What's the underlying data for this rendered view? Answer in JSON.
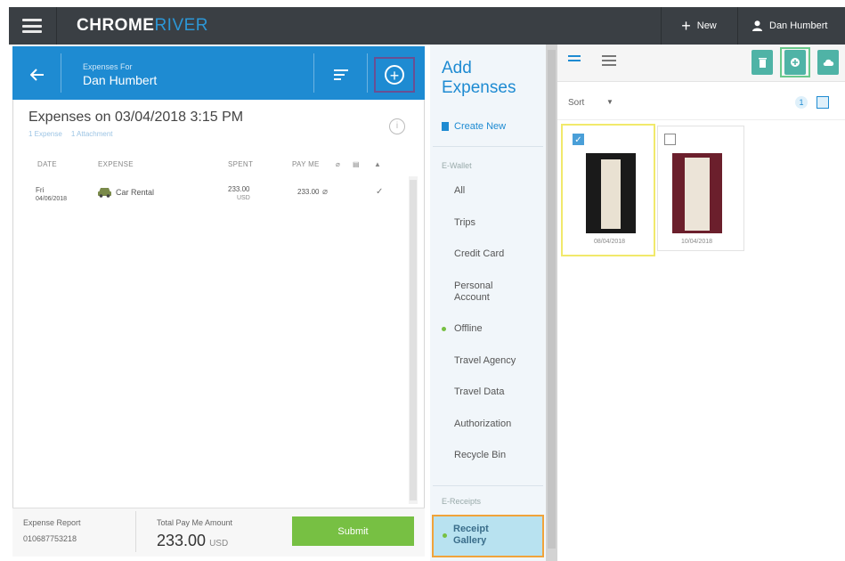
{
  "topbar": {
    "logo_main": "CHROME",
    "logo_accent": "RIVER",
    "new_label": "New",
    "user_name": "Dan Humbert"
  },
  "left": {
    "header_small": "Expenses For",
    "header_name": "Dan Humbert",
    "title": "Expenses on 03/04/2018 3:15 PM",
    "meta_expenses": "1 Expense",
    "meta_attachments": "1 Attachment",
    "columns": {
      "date": "DATE",
      "expense": "EXPENSE",
      "spent": "SPENT",
      "payme": "PAY ME"
    },
    "rows": [
      {
        "day": "Fri",
        "date": "04/06/2018",
        "expense": "Car Rental",
        "spent": "233.00",
        "spent_currency": "USD",
        "payme": "233.00"
      }
    ],
    "footer": {
      "report_label": "Expense Report",
      "report_number": "010687753218",
      "total_label": "Total Pay Me Amount",
      "total_amount": "233.00",
      "total_currency": "USD",
      "submit_label": "Submit"
    }
  },
  "middle": {
    "title_line1": "Add",
    "title_line2": "Expenses",
    "create_new": "Create New",
    "inbox_label": "E-Wallet",
    "nav": [
      "All",
      "Trips",
      "Credit Card",
      "Personal Account",
      "Offline",
      "Travel Agency",
      "Travel Data",
      "Authorization",
      "Recycle Bin"
    ],
    "receipts_label": "E-Receipts",
    "gallery_line1": "Receipt",
    "gallery_line2": "Gallery"
  },
  "right": {
    "sort_label": "Sort",
    "count": "1",
    "cards": [
      {
        "date": "08/04/2018",
        "checked": true
      },
      {
        "date": "10/04/2018",
        "checked": false
      }
    ]
  }
}
